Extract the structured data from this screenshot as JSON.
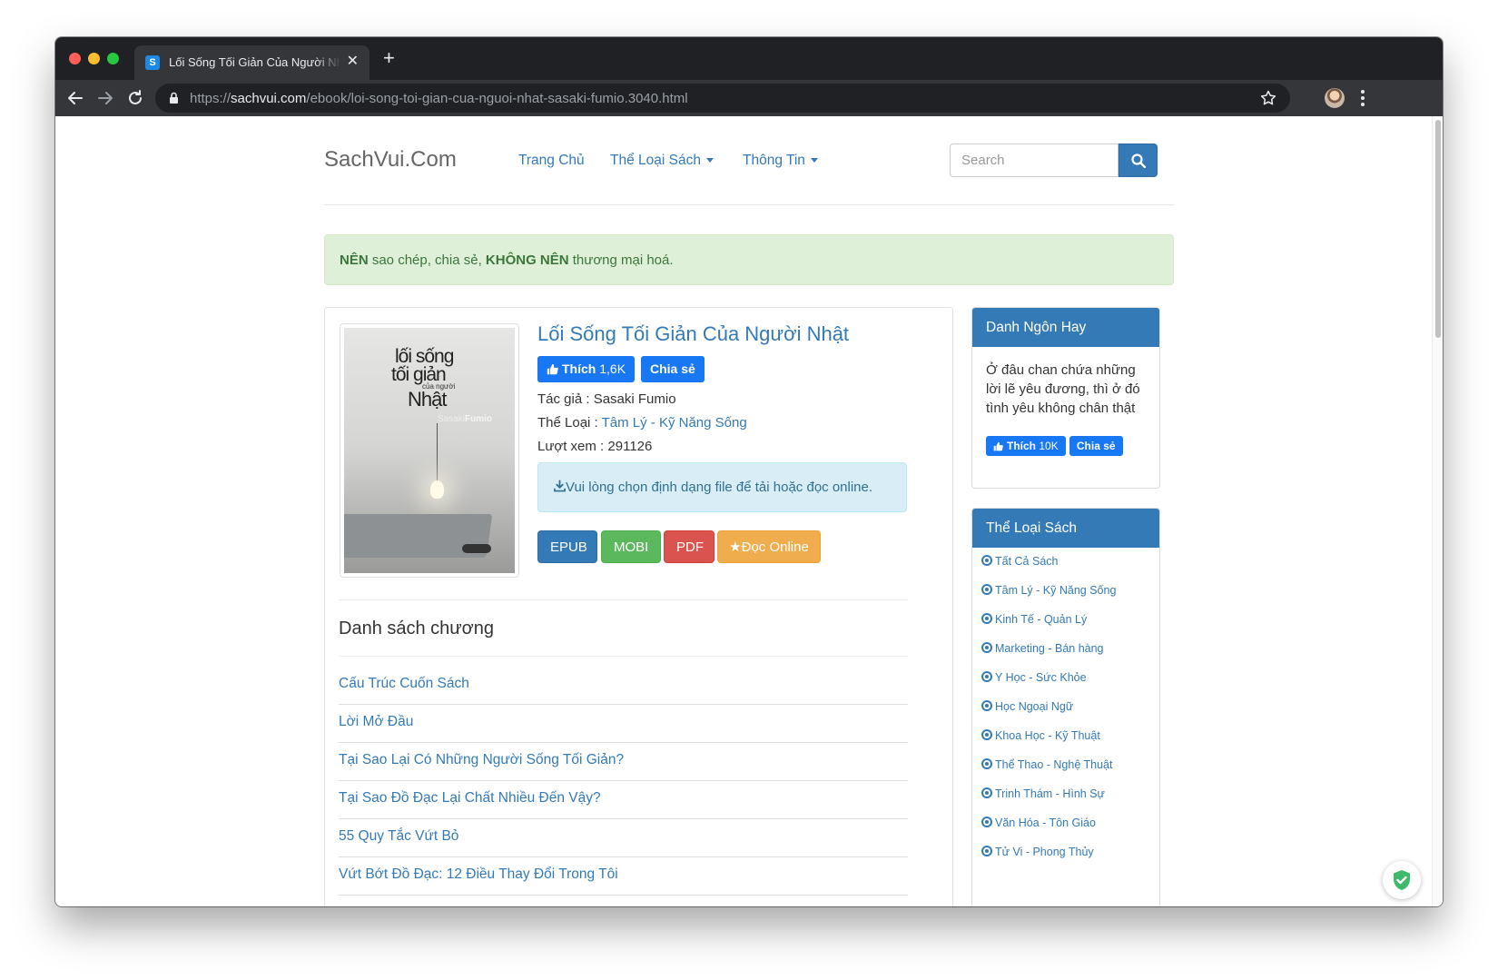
{
  "browser": {
    "tab_title": "Lối Sống Tối Giản Của Người Nhật - Sasaki Fumio",
    "tab_favicon": "S",
    "url_scheme": "https://",
    "url_host": "sachvui.com",
    "url_path": "/ebook/loi-song-toi-gian-cua-nguoi-nhat-sasaki-fumio.3040.html"
  },
  "nav": {
    "brand": "SachVui.Com",
    "items": [
      "Trang Chủ",
      "Thể Loại Sách",
      "Thông Tin"
    ],
    "search_placeholder": "Search"
  },
  "notice": {
    "strong1": "NÊN",
    "text1": " sao chép, chia sẻ, ",
    "strong2": "KHÔNG NÊN",
    "text2": " thương mại hoá."
  },
  "book": {
    "title": "Lối Sống Tối Giản Của Người Nhật",
    "like_label": "Thích",
    "like_count": "1,6K",
    "share_label": "Chia sẻ",
    "author_label": "Tác giả : ",
    "author": "Sasaki Fumio",
    "category_label": "Thể Loại : ",
    "category": "Tâm Lý - Kỹ Năng Sống",
    "views_label": "Lượt xem : ",
    "views": "291126",
    "download_hint": "Vui lòng chọn định dạng file để tải hoặc đọc online.",
    "cover": {
      "line1": "lối sống",
      "line2": "tối giản",
      "line3": "của người",
      "line4": "Nhật",
      "author_first": "Sasaki",
      "author_last": "Fumio"
    }
  },
  "formats": {
    "epub": "EPUB",
    "mobi": "MOBI",
    "pdf": "PDF",
    "online": "★Đọc Online"
  },
  "chapters": {
    "heading": "Danh sách chương",
    "items": [
      "Cấu Trúc Cuốn Sách",
      "Lời Mở Đầu",
      "Tại Sao Lại Có Những Người Sống Tối Giản?",
      "Tại Sao Đồ Đạc Lại Chất Nhiều Đến Vậy?",
      "55 Quy Tắc Vứt Bỏ",
      "Vứt Bớt Đồ Đạc: 12 Điều Thay Đổi Trong Tôi"
    ]
  },
  "quote_panel": {
    "heading": "Danh Ngôn Hay",
    "text": "Ở đâu chan chứa những lời lẽ yêu đương, thì ở đó tình yêu không chân thật",
    "like_label": "Thích",
    "like_count": "10K",
    "share_label": "Chia sẻ"
  },
  "category_panel": {
    "heading": "Thể Loại Sách",
    "items": [
      "Tất Cả Sách",
      "Tâm Lý - Kỹ Năng Sống",
      "Kinh Tế - Quản Lý",
      "Marketing - Bán hàng",
      "Y Học - Sức Khỏe",
      "Học Ngoại Ngữ",
      "Khoa Học - Kỹ Thuật",
      "Thể Thao - Nghệ Thuật",
      "Trinh Thám - Hình Sự",
      "Văn Hóa - Tôn Giáo",
      "Tử Vi - Phong Thủy"
    ]
  },
  "colors": {
    "primary": "#337ab7",
    "success": "#5cb85c",
    "danger": "#d9534f",
    "warning": "#f0ad4e",
    "facebook": "#1877f2"
  }
}
